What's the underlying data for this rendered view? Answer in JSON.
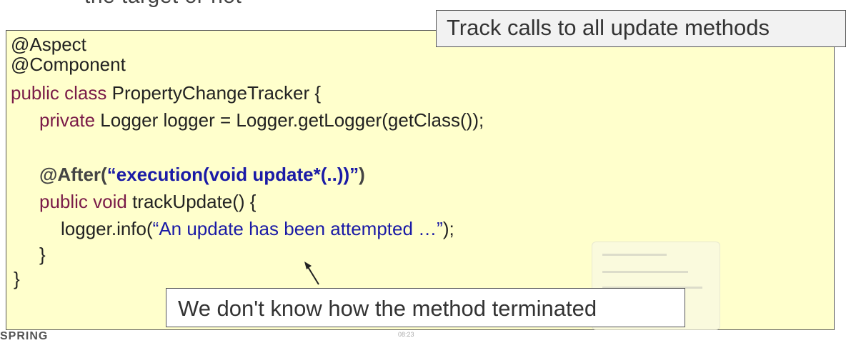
{
  "header": {
    "partial_text": "the target or not"
  },
  "code": {
    "line1": "@Aspect",
    "line2": "@Component",
    "line3_kw": "public class",
    "line3_rest": " PropertyChangeTracker {",
    "line4_kw": "private",
    "line4_rest": " Logger logger = Logger.getLogger(getClass());",
    "line6_ann": "@After(",
    "line6_str": "“execution(void update*(..))”",
    "line6_close": ")",
    "line7_kw": "public void",
    "line7_rest": " trackUpdate() {",
    "line8_pre": "logger.info(",
    "line8_str": "“An update has been attempted …”",
    "line8_post": ");",
    "line9": "}",
    "line10": "}"
  },
  "callouts": {
    "top": "Track calls to all update methods",
    "bottom": "We don't know how the method terminated"
  },
  "footer": {
    "logo_partial": "SPRING",
    "timestamp": "08:23"
  },
  "colors": {
    "code_background": "#ffffcc",
    "keyword": "#7a1b48",
    "string": "#1a1aa6"
  }
}
